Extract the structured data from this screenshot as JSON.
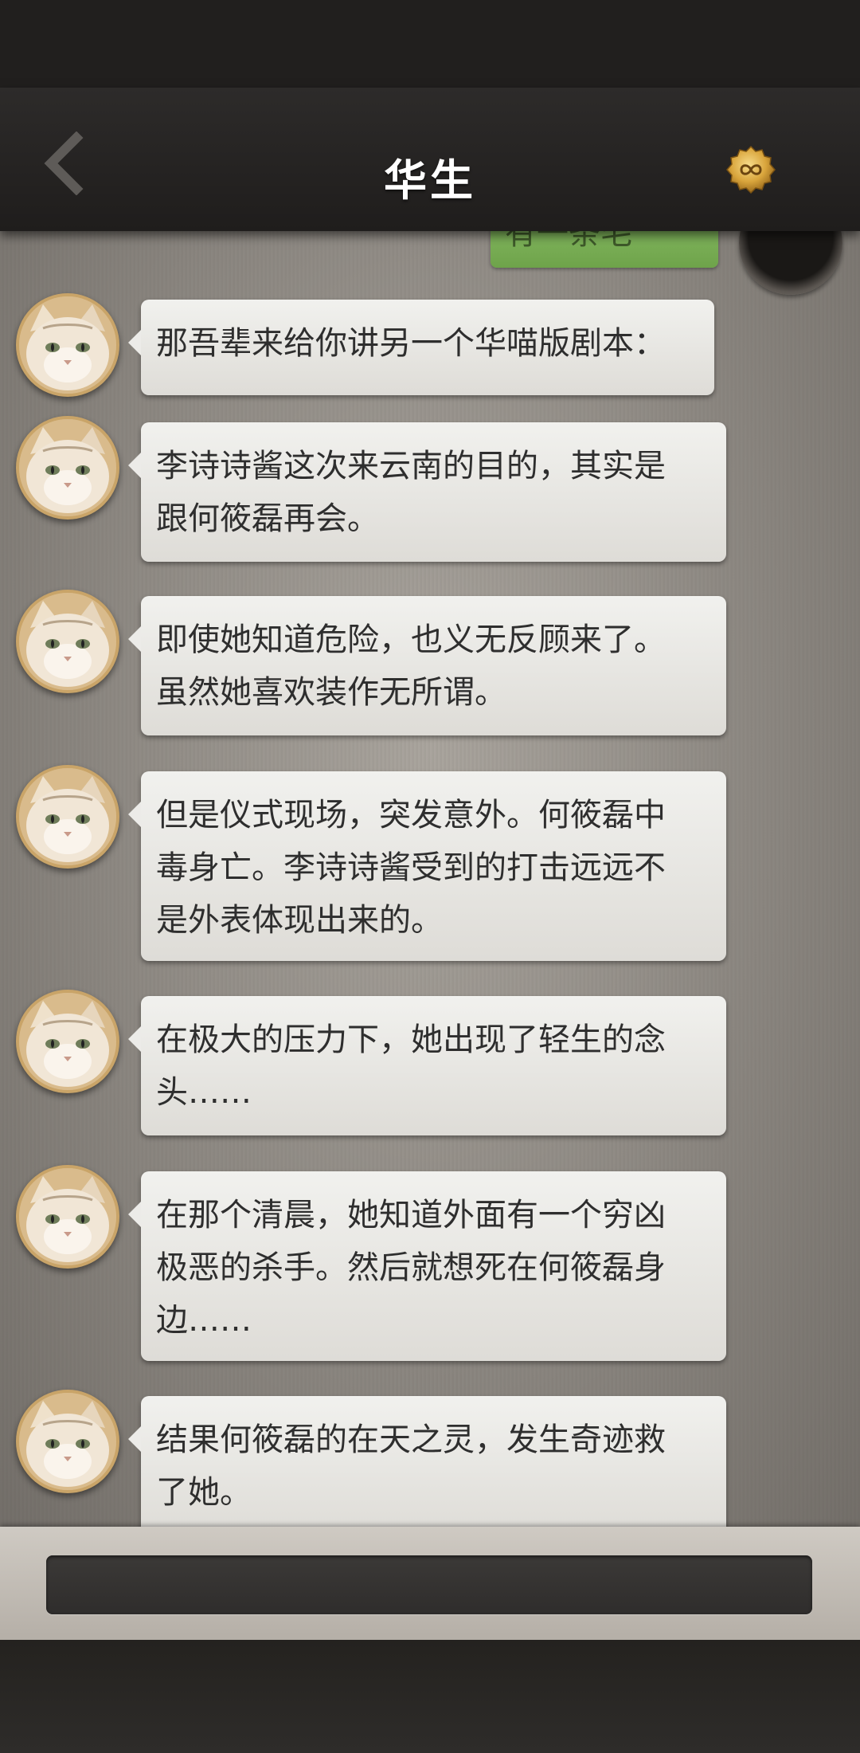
{
  "header": {
    "title": "华生"
  },
  "colors": {
    "header_bg": "#2a2827",
    "chat_bg": "#a8a39c",
    "bubble_bg": "#ecebe8",
    "sent_bubble": "#7fb35a",
    "avatar_ring": "#c9a468"
  },
  "icons": {
    "back": "chevron-left-icon",
    "badge": "infinity-badge-icon",
    "avatar": "cat-avatar"
  },
  "partial_sent_message": {
    "text": "有一条毛"
  },
  "messages": [
    {
      "text": "那吾辈来给你讲另一个华喵版剧本："
    },
    {
      "text": "李诗诗酱这次来云南的目的，其实是\n跟何筱磊再会。"
    },
    {
      "text": "即使她知道危险，也义无反顾来了。\n虽然她喜欢装作无所谓。"
    },
    {
      "text": "但是仪式现场，突发意外。何筱磊中\n毒身亡。李诗诗酱受到的打击远远不\n是外表体现出来的。"
    },
    {
      "text": "在极大的压力下，她出现了轻生的念\n头……"
    },
    {
      "text": "在那个清晨，她知道外面有一个穷凶\n极恶的杀手。然后就想死在何筱磊身\n边……"
    },
    {
      "text": "结果何筱磊的在天之灵，发生奇迹救\n了她。"
    }
  ],
  "input": {
    "value": "",
    "placeholder": ""
  }
}
